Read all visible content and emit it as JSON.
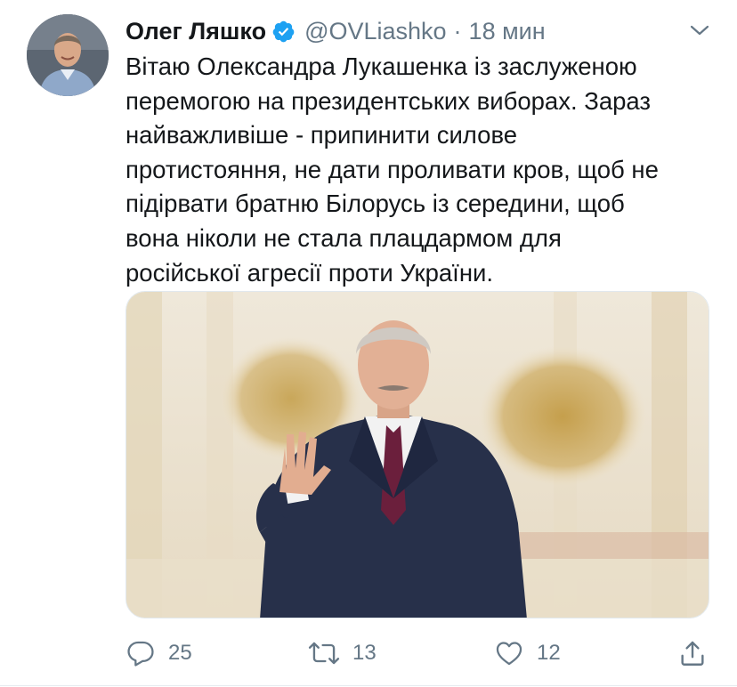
{
  "tweet": {
    "author_name": "Олег Ляшко",
    "handle": "@OVLiashko",
    "separator": "·",
    "time": "18 мин",
    "lines": [
      "Вітаю Олександра Лукашенка із заслуженою",
      "перемогою на президентських виборах. Зараз",
      "найважливіше - припинити силове",
      "протистояння, не дати проливати кров, щоб не",
      "підірвати братню Білорусь із середини, щоб",
      "вона ніколи не стала плацдармом для",
      "російської агресії проти України."
    ],
    "media_alt_icon": "photo-of-waving-man"
  },
  "actions": {
    "reply_count": "25",
    "retweet_count": "13",
    "like_count": "12"
  },
  "icons": {
    "verified": "verified-badge-icon",
    "caret": "chevron-down-icon",
    "reply": "reply-icon",
    "retweet": "retweet-icon",
    "like": "heart-icon",
    "share": "share-icon"
  },
  "colors": {
    "verified": "#1da1f2",
    "secondary_text": "#657786",
    "primary_text": "#14171a"
  }
}
